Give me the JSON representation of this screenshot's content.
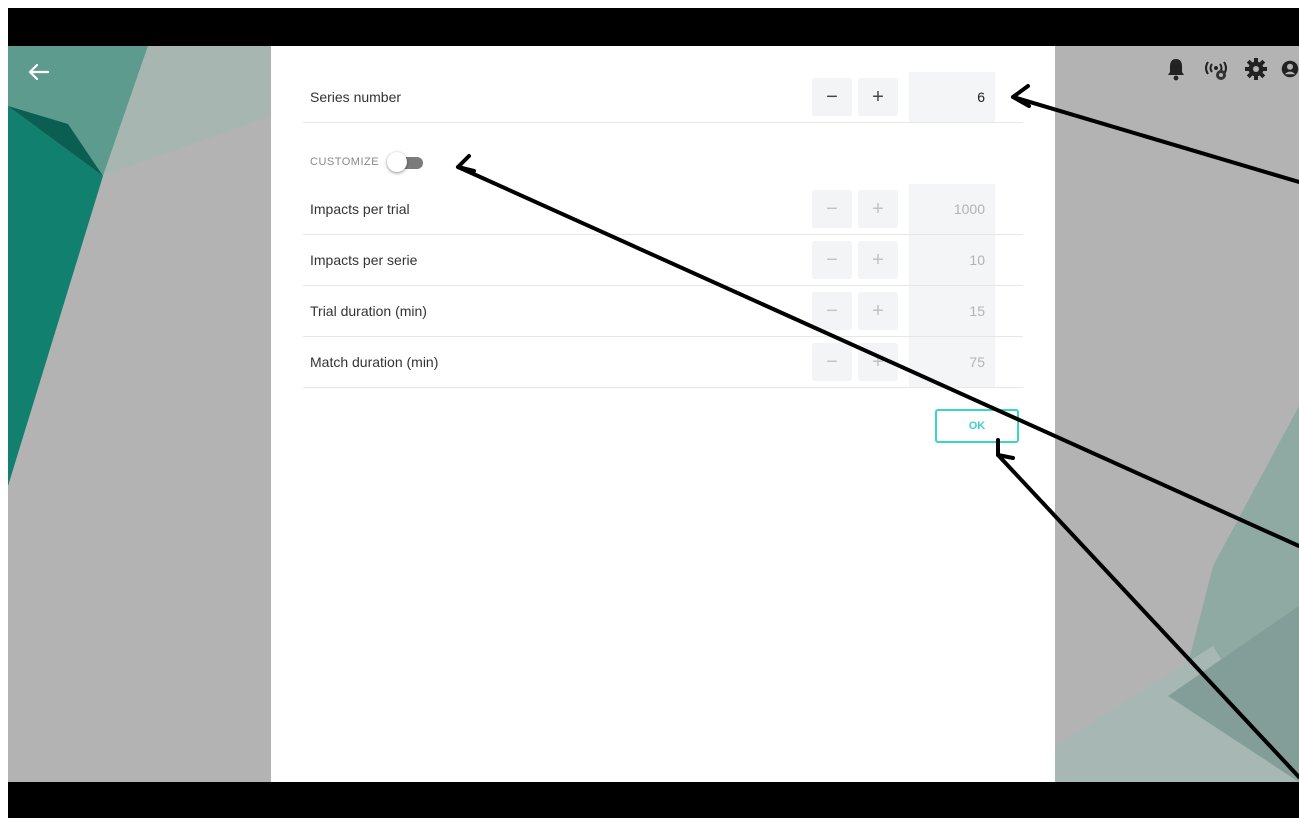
{
  "header": {
    "back_icon": "arrow-left-icon",
    "icons": [
      "bell-icon",
      "wireless-sensor-icon",
      "gear-icon",
      "user-icon"
    ]
  },
  "dialog": {
    "series_number": {
      "label": "Series number",
      "minus": "−",
      "plus": "+",
      "value": "6"
    },
    "customize": {
      "label": "CUSTOMIZE",
      "enabled": false
    },
    "settings": [
      {
        "label": "Impacts per trial",
        "minus": "−",
        "plus": "+",
        "value": "1000"
      },
      {
        "label": "Impacts per serie",
        "minus": "−",
        "plus": "+",
        "value": "10"
      },
      {
        "label": "Trial duration (min)",
        "minus": "−",
        "plus": "+",
        "value": "15"
      },
      {
        "label": "Match duration (min)",
        "minus": "−",
        "plus": "+",
        "value": "75"
      }
    ],
    "ok_label": "OK"
  },
  "colors": {
    "accent": "#3fd3c4",
    "teal_dark": "#0f8c78",
    "overlay_gray": "#b3b3b3"
  }
}
